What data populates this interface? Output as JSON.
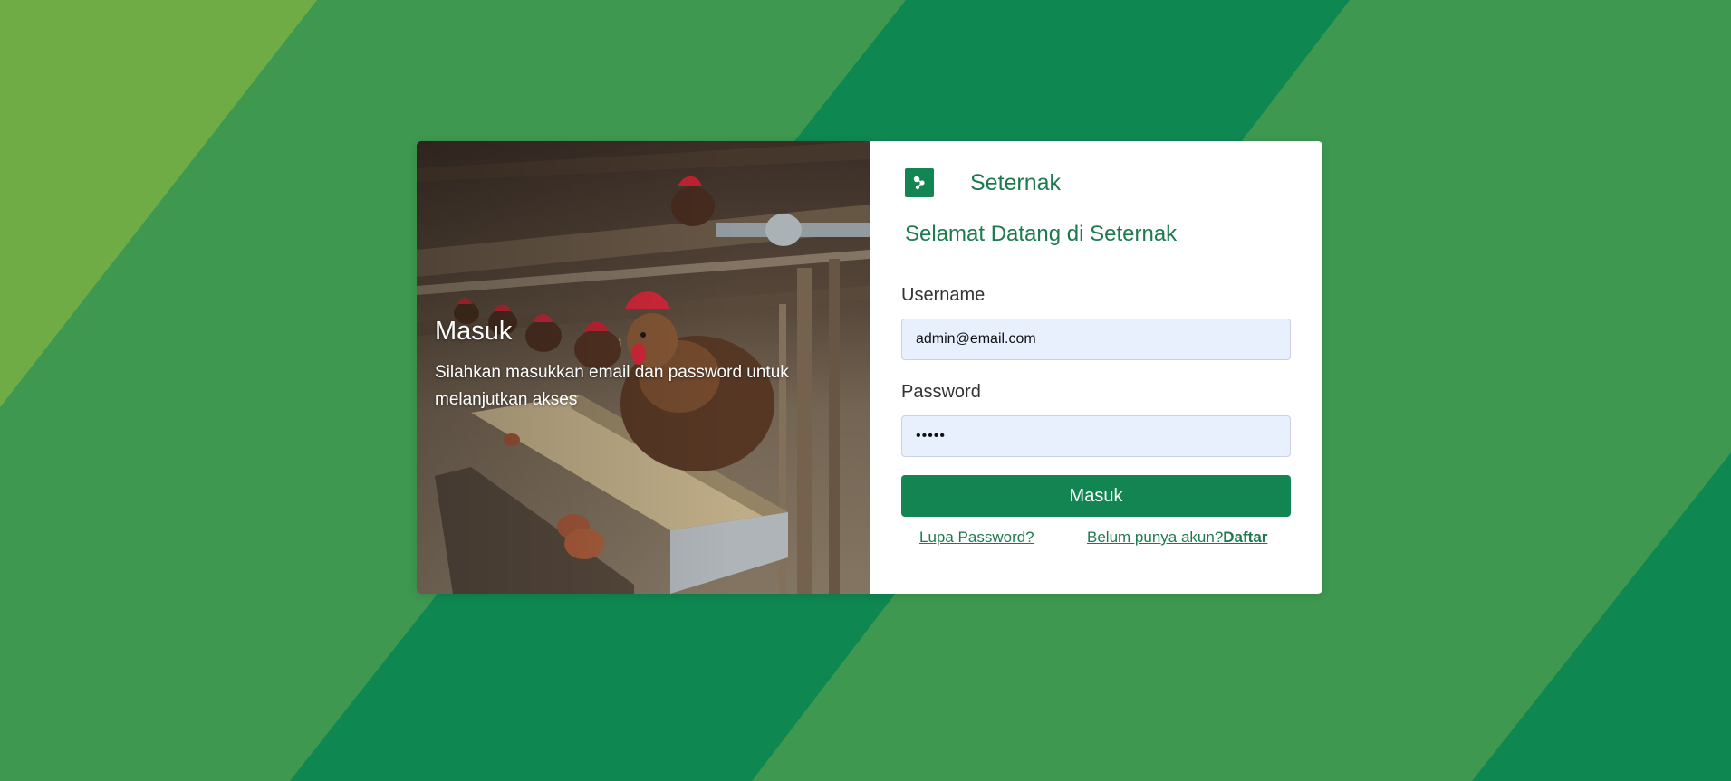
{
  "colors": {
    "primary": "#138552",
    "brand_text": "#1d7a4e",
    "input_bg": "#e8effd",
    "background_green": "#3e9850",
    "background_light": "#6fac46",
    "background_dark": "#0f8751"
  },
  "photo_panel": {
    "title": "Masuk",
    "subtitle": "Silahkan masukkan email dan password untuk melanjutkan akses"
  },
  "brand": {
    "name": "Seternak",
    "logo_icon": "seternak-logo-icon"
  },
  "form": {
    "welcome": "Selamat Datang di Seternak",
    "username_label": "Username",
    "username_value": "admin@email.com",
    "password_label": "Password",
    "password_value": "•••••",
    "submit_label": "Masuk"
  },
  "links": {
    "forgot_password": "Lupa Password?",
    "register_prompt": "Belum punya akun?",
    "register_link": "Daftar"
  }
}
